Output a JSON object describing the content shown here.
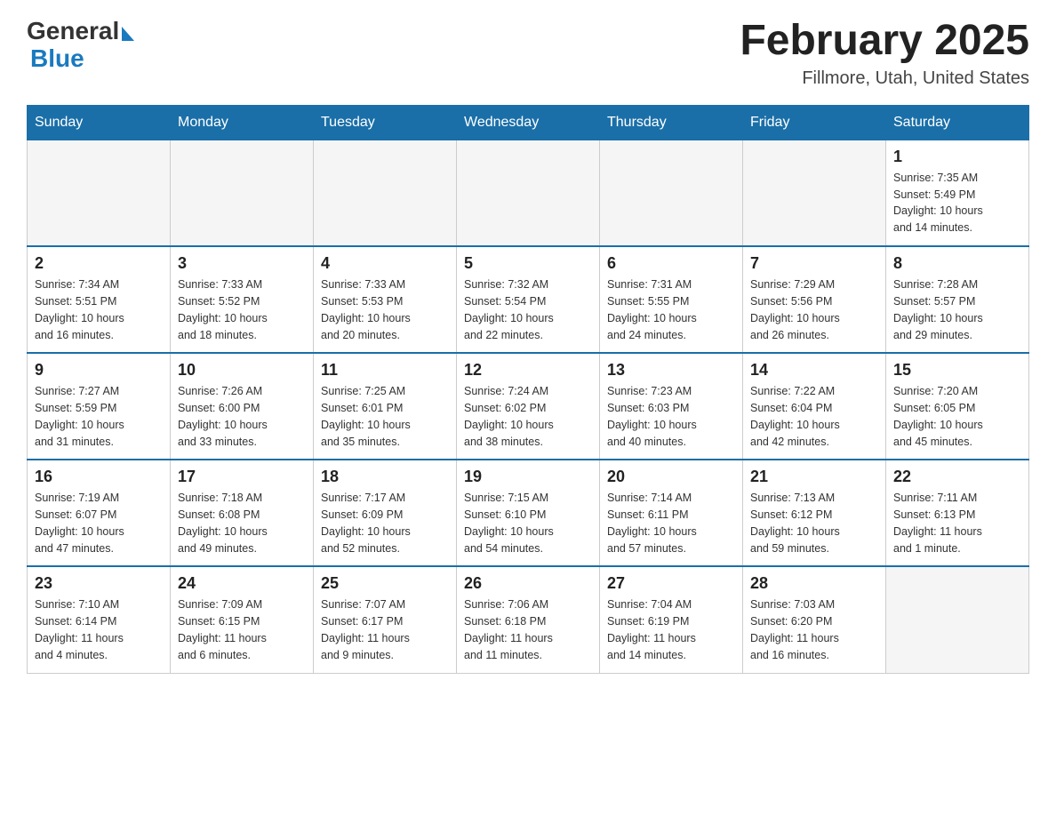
{
  "header": {
    "logo_general": "General",
    "logo_blue": "Blue",
    "month_title": "February 2025",
    "location": "Fillmore, Utah, United States"
  },
  "days_of_week": [
    "Sunday",
    "Monday",
    "Tuesday",
    "Wednesday",
    "Thursday",
    "Friday",
    "Saturday"
  ],
  "weeks": [
    [
      {
        "day": "",
        "info": ""
      },
      {
        "day": "",
        "info": ""
      },
      {
        "day": "",
        "info": ""
      },
      {
        "day": "",
        "info": ""
      },
      {
        "day": "",
        "info": ""
      },
      {
        "day": "",
        "info": ""
      },
      {
        "day": "1",
        "info": "Sunrise: 7:35 AM\nSunset: 5:49 PM\nDaylight: 10 hours\nand 14 minutes."
      }
    ],
    [
      {
        "day": "2",
        "info": "Sunrise: 7:34 AM\nSunset: 5:51 PM\nDaylight: 10 hours\nand 16 minutes."
      },
      {
        "day": "3",
        "info": "Sunrise: 7:33 AM\nSunset: 5:52 PM\nDaylight: 10 hours\nand 18 minutes."
      },
      {
        "day": "4",
        "info": "Sunrise: 7:33 AM\nSunset: 5:53 PM\nDaylight: 10 hours\nand 20 minutes."
      },
      {
        "day": "5",
        "info": "Sunrise: 7:32 AM\nSunset: 5:54 PM\nDaylight: 10 hours\nand 22 minutes."
      },
      {
        "day": "6",
        "info": "Sunrise: 7:31 AM\nSunset: 5:55 PM\nDaylight: 10 hours\nand 24 minutes."
      },
      {
        "day": "7",
        "info": "Sunrise: 7:29 AM\nSunset: 5:56 PM\nDaylight: 10 hours\nand 26 minutes."
      },
      {
        "day": "8",
        "info": "Sunrise: 7:28 AM\nSunset: 5:57 PM\nDaylight: 10 hours\nand 29 minutes."
      }
    ],
    [
      {
        "day": "9",
        "info": "Sunrise: 7:27 AM\nSunset: 5:59 PM\nDaylight: 10 hours\nand 31 minutes."
      },
      {
        "day": "10",
        "info": "Sunrise: 7:26 AM\nSunset: 6:00 PM\nDaylight: 10 hours\nand 33 minutes."
      },
      {
        "day": "11",
        "info": "Sunrise: 7:25 AM\nSunset: 6:01 PM\nDaylight: 10 hours\nand 35 minutes."
      },
      {
        "day": "12",
        "info": "Sunrise: 7:24 AM\nSunset: 6:02 PM\nDaylight: 10 hours\nand 38 minutes."
      },
      {
        "day": "13",
        "info": "Sunrise: 7:23 AM\nSunset: 6:03 PM\nDaylight: 10 hours\nand 40 minutes."
      },
      {
        "day": "14",
        "info": "Sunrise: 7:22 AM\nSunset: 6:04 PM\nDaylight: 10 hours\nand 42 minutes."
      },
      {
        "day": "15",
        "info": "Sunrise: 7:20 AM\nSunset: 6:05 PM\nDaylight: 10 hours\nand 45 minutes."
      }
    ],
    [
      {
        "day": "16",
        "info": "Sunrise: 7:19 AM\nSunset: 6:07 PM\nDaylight: 10 hours\nand 47 minutes."
      },
      {
        "day": "17",
        "info": "Sunrise: 7:18 AM\nSunset: 6:08 PM\nDaylight: 10 hours\nand 49 minutes."
      },
      {
        "day": "18",
        "info": "Sunrise: 7:17 AM\nSunset: 6:09 PM\nDaylight: 10 hours\nand 52 minutes."
      },
      {
        "day": "19",
        "info": "Sunrise: 7:15 AM\nSunset: 6:10 PM\nDaylight: 10 hours\nand 54 minutes."
      },
      {
        "day": "20",
        "info": "Sunrise: 7:14 AM\nSunset: 6:11 PM\nDaylight: 10 hours\nand 57 minutes."
      },
      {
        "day": "21",
        "info": "Sunrise: 7:13 AM\nSunset: 6:12 PM\nDaylight: 10 hours\nand 59 minutes."
      },
      {
        "day": "22",
        "info": "Sunrise: 7:11 AM\nSunset: 6:13 PM\nDaylight: 11 hours\nand 1 minute."
      }
    ],
    [
      {
        "day": "23",
        "info": "Sunrise: 7:10 AM\nSunset: 6:14 PM\nDaylight: 11 hours\nand 4 minutes."
      },
      {
        "day": "24",
        "info": "Sunrise: 7:09 AM\nSunset: 6:15 PM\nDaylight: 11 hours\nand 6 minutes."
      },
      {
        "day": "25",
        "info": "Sunrise: 7:07 AM\nSunset: 6:17 PM\nDaylight: 11 hours\nand 9 minutes."
      },
      {
        "day": "26",
        "info": "Sunrise: 7:06 AM\nSunset: 6:18 PM\nDaylight: 11 hours\nand 11 minutes."
      },
      {
        "day": "27",
        "info": "Sunrise: 7:04 AM\nSunset: 6:19 PM\nDaylight: 11 hours\nand 14 minutes."
      },
      {
        "day": "28",
        "info": "Sunrise: 7:03 AM\nSunset: 6:20 PM\nDaylight: 11 hours\nand 16 minutes."
      },
      {
        "day": "",
        "info": ""
      }
    ]
  ]
}
